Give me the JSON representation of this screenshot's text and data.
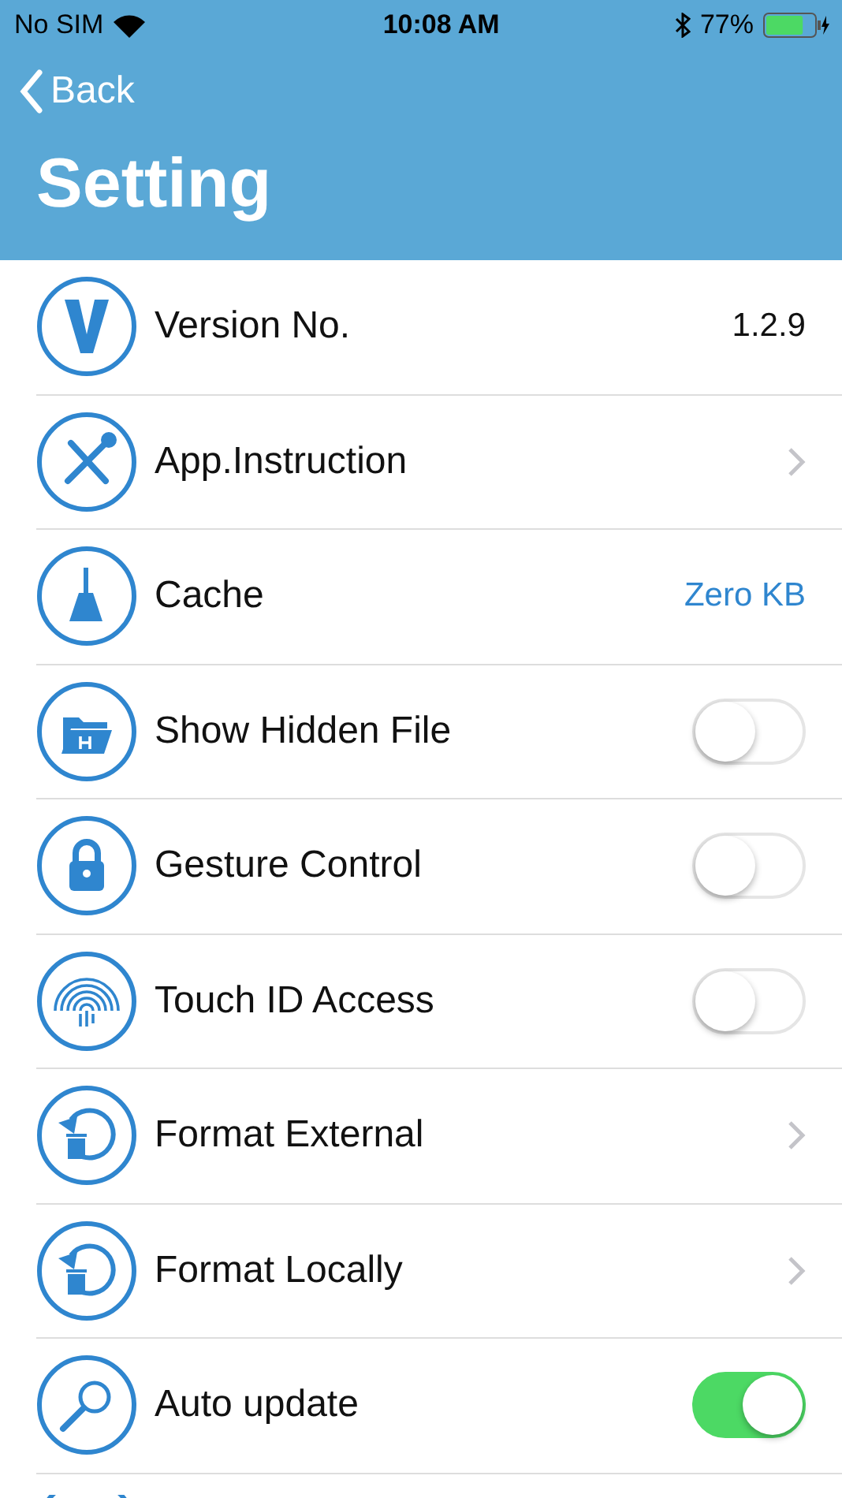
{
  "status_bar": {
    "carrier": "No SIM",
    "time": "10:08 AM",
    "battery": "77%",
    "level": 0.77
  },
  "nav": {
    "back": "Back",
    "title": "Setting"
  },
  "rows": [
    {
      "kind": "value",
      "label": "Version No.",
      "value": "1.2.9"
    },
    {
      "kind": "chevron",
      "label": "App.Instruction"
    },
    {
      "kind": "link",
      "label": "Cache",
      "value": "Zero KB"
    },
    {
      "kind": "toggle",
      "label": "Show Hidden File",
      "on": false
    },
    {
      "kind": "toggle",
      "label": "Gesture Control",
      "on": false
    },
    {
      "kind": "toggle",
      "label": "Touch ID Access",
      "on": false
    },
    {
      "kind": "chevron",
      "label": "Format External"
    },
    {
      "kind": "chevron",
      "label": "Format Locally"
    },
    {
      "kind": "toggle",
      "label": "Auto update",
      "on": true
    }
  ]
}
